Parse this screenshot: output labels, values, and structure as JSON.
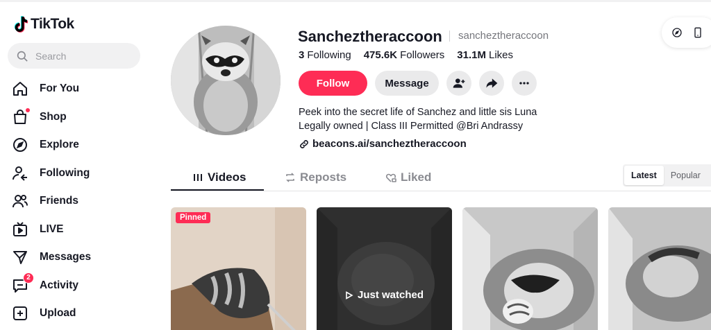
{
  "app": {
    "name": "TikTok"
  },
  "search": {
    "placeholder": "Search"
  },
  "nav": [
    {
      "label": "For You",
      "icon": "home-icon"
    },
    {
      "label": "Shop",
      "icon": "shopping-bag-icon"
    },
    {
      "label": "Explore",
      "icon": "compass-icon"
    },
    {
      "label": "Following",
      "icon": "following-user-icon"
    },
    {
      "label": "Friends",
      "icon": "friends-icon"
    },
    {
      "label": "LIVE",
      "icon": "tv-live-icon"
    },
    {
      "label": "Messages",
      "icon": "send-icon"
    },
    {
      "label": "Activity",
      "icon": "activity-icon",
      "badge": "2"
    },
    {
      "label": "Upload",
      "icon": "plus-square-icon"
    }
  ],
  "profile": {
    "username": "Sancheztheraccoon",
    "handle": "sancheztheraccoon",
    "following_count": "3",
    "following_label": "Following",
    "followers_count": "475.6K",
    "followers_label": "Followers",
    "likes_count": "31.1M",
    "likes_label": "Likes",
    "bio_line1": "Peek into the secret life of Sanchez and little sis Luna",
    "bio_line2": "Legally owned | Class III Permitted @Bri Andrassy",
    "link": "beacons.ai/sancheztheraccoon"
  },
  "actions": {
    "follow": "Follow",
    "message": "Message"
  },
  "tabs": {
    "videos": "Videos",
    "reposts": "Reposts",
    "liked": "Liked"
  },
  "sort": {
    "latest": "Latest",
    "popular": "Popular"
  },
  "videos": {
    "pinned_label": "Pinned",
    "watched_label": "Just watched"
  },
  "colors": {
    "accent": "#fe2c55",
    "text": "#161823",
    "muted": "#8a8b91"
  }
}
